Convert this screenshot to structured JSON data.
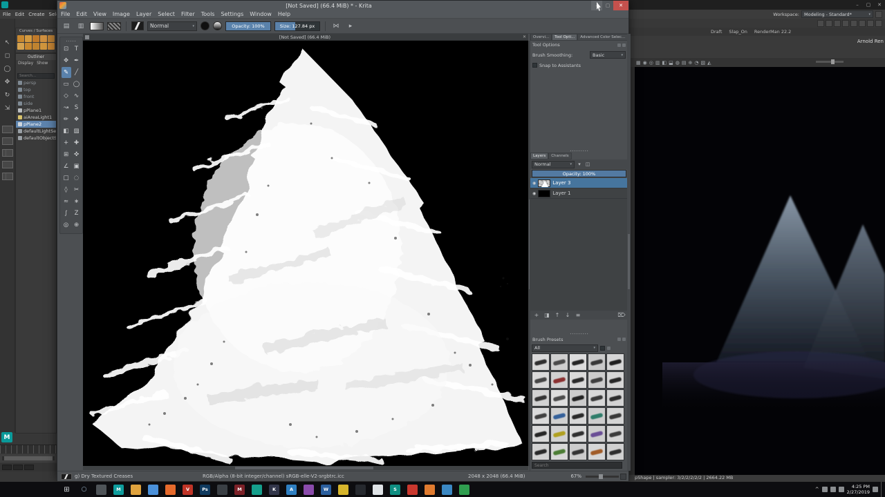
{
  "maya": {
    "menu": [
      "File",
      "Edit",
      "Create",
      "Select"
    ],
    "workspace_label": "Workspace:",
    "workspace_value": "Modeling - Standard*",
    "renderman_draft": "Draft",
    "renderman_snap": "Slap_On",
    "renderman_version": "RenderMan 22.2",
    "render_view_title": "Arnold Ren",
    "shelf_tab": "Curves / Surfaces",
    "shelf_icons": [
      "#c8882f",
      "#d49a3f",
      "#c07a2a",
      "#cf9040",
      "#b97f35",
      "#d4a24f",
      "#c8882f",
      "#bf8330",
      "#d0953d",
      "#c68534"
    ],
    "tool_icons": [
      {
        "g": "↖",
        "n": "select-tool-icon"
      },
      {
        "g": "◻",
        "n": "lasso-select-tool-icon"
      },
      {
        "g": "◯",
        "n": "paint-select-tool-icon"
      },
      {
        "g": "✥",
        "n": "move-tool-icon"
      },
      {
        "g": "↻",
        "n": "rotate-tool-icon"
      },
      {
        "g": "⇲",
        "n": "scale-tool-icon"
      }
    ],
    "outliner": {
      "title": "Outliner",
      "menu_display": "Display",
      "menu_show": "Show",
      "search_placeholder": "Search...",
      "items": [
        {
          "label": "persp",
          "cls": "muted",
          "icon": "#7f8a94"
        },
        {
          "label": "top",
          "cls": "muted",
          "icon": "#7f8a94"
        },
        {
          "label": "front",
          "cls": "muted",
          "icon": "#7f8a94"
        },
        {
          "label": "side",
          "cls": "muted",
          "icon": "#7f8a94"
        },
        {
          "label": "pPlane1",
          "cls": "",
          "icon": "#b9bdc1"
        },
        {
          "label": "aiAreaLight1",
          "cls": "",
          "icon": "#d8c26a"
        },
        {
          "label": "pPlane2",
          "cls": "selected",
          "icon": "#cfd6dd"
        },
        {
          "label": "defaultLightSet",
          "cls": "",
          "icon": "#9aa0a6"
        },
        {
          "label": "defaultObjectSet",
          "cls": "",
          "icon": "#9aa0a6"
        }
      ]
    },
    "viewport_icons": [
      "▦",
      "◉",
      "◎",
      "▥",
      "◧",
      "⬓",
      "◍",
      "▤",
      "⊕",
      "◔",
      "▧",
      "◭"
    ],
    "status_info": "pShape | sampler: 3/2/2/2/2/2 | 2664.22 MB"
  },
  "os": {
    "window_buttons": {
      "minimize": "–",
      "maximize": "▢",
      "close": "✕"
    }
  },
  "krita": {
    "title": "[Not Saved] (66.4 MiB) * - Krita",
    "menu": [
      "File",
      "Edit",
      "View",
      "Image",
      "Layer",
      "Select",
      "Filter",
      "Tools",
      "Settings",
      "Window",
      "Help"
    ],
    "toolbar": {
      "new_icon": "▤",
      "open_icon": "▥",
      "blend_mode": "Normal",
      "opacity_label": "Opacity:",
      "opacity_value": "100%",
      "opacity_fill": "100%",
      "size_label": "Size:",
      "size_value": "127.84 px",
      "size_fill": "46%",
      "mirror_icon": "⋈",
      "wrap_icon": "▸"
    },
    "canvas_tab": "[Not Saved]  (66.4 MiB)",
    "canvas_tab_close": "✕",
    "toolbox": [
      {
        "g": "⊡",
        "n": "transform-tool",
        "cls": ""
      },
      {
        "g": "T",
        "n": "text-tool",
        "cls": ""
      },
      {
        "g": "✥",
        "n": "move-tool",
        "cls": ""
      },
      {
        "g": "✒",
        "n": "calligraphy-tool",
        "cls": ""
      },
      {
        "g": "✎",
        "n": "freehand-brush-tool",
        "cls": "active"
      },
      {
        "g": "╱",
        "n": "line-tool",
        "cls": ""
      },
      {
        "g": "▭",
        "n": "rectangle-tool",
        "cls": ""
      },
      {
        "g": "◯",
        "n": "ellipse-tool",
        "cls": ""
      },
      {
        "g": "◇",
        "n": "polygon-tool",
        "cls": ""
      },
      {
        "g": "∿",
        "n": "polyline-tool",
        "cls": ""
      },
      {
        "g": "↝",
        "n": "bezier-curve-tool",
        "cls": ""
      },
      {
        "g": "S",
        "n": "freehand-path-tool",
        "cls": ""
      },
      {
        "g": "✏",
        "n": "dynamic-brush-tool",
        "cls": ""
      },
      {
        "g": "❖",
        "n": "multibrush-tool",
        "cls": ""
      },
      {
        "g": "◧",
        "n": "fill-tool",
        "cls": ""
      },
      {
        "g": "▨",
        "n": "gradient-tool",
        "cls": ""
      },
      {
        "g": "+",
        "n": "color-sampler-tool",
        "cls": ""
      },
      {
        "g": "✚",
        "n": "smart-patch-tool",
        "cls": ""
      },
      {
        "g": "⊞",
        "n": "crop-tool",
        "cls": ""
      },
      {
        "g": "✜",
        "n": "assistants-tool",
        "cls": ""
      },
      {
        "g": "∠",
        "n": "measure-tool",
        "cls": ""
      },
      {
        "g": "▣",
        "n": "reference-images-tool",
        "cls": ""
      },
      {
        "g": "□",
        "n": "rect-select-tool",
        "cls": ""
      },
      {
        "g": "◌",
        "n": "ellipse-select-tool",
        "cls": ""
      },
      {
        "g": "◊",
        "n": "polygon-select-tool",
        "cls": ""
      },
      {
        "g": "✂",
        "n": "freehand-select-tool",
        "cls": ""
      },
      {
        "g": "≈",
        "n": "contiguous-select-tool",
        "cls": ""
      },
      {
        "g": "∗",
        "n": "similar-select-tool",
        "cls": ""
      },
      {
        "g": "∫",
        "n": "bezier-select-tool",
        "cls": ""
      },
      {
        "g": "Z",
        "n": "magnetic-select-tool",
        "cls": ""
      },
      {
        "g": "◎",
        "n": "zoom-tool",
        "cls": ""
      },
      {
        "g": "⊕",
        "n": "pan-tool",
        "cls": ""
      }
    ],
    "docker_tabs": [
      {
        "label": "Overvi...",
        "cls": ""
      },
      {
        "label": "Tool Opti...",
        "cls": "active"
      },
      {
        "label": "Advanced Color Selec...",
        "cls": ""
      }
    ],
    "tool_options": {
      "title": "Tool Options",
      "brush_smoothing_label": "Brush Smoothing:",
      "brush_smoothing_value": "Basic",
      "snap_label": "Snap to Assistants"
    },
    "layers": {
      "tab_layers": "Layers",
      "tab_channels": "Channels",
      "blend_mode": "Normal",
      "opacity_label": "Opacity:",
      "opacity_value": "100%",
      "opacity_fill": "100%",
      "rows": [
        {
          "name": "Layer 3",
          "cls": "selected",
          "thumb": "thumb-tree",
          "eye": "◉"
        },
        {
          "name": "Layer 1",
          "cls": "",
          "thumb": "thumb-black",
          "eye": "◉"
        }
      ],
      "buttons": [
        {
          "g": "+",
          "n": "add-layer-button"
        },
        {
          "g": "◨",
          "n": "duplicate-layer-button"
        },
        {
          "g": "↑",
          "n": "move-layer-up-button"
        },
        {
          "g": "↓",
          "n": "move-layer-down-button"
        },
        {
          "g": "≡",
          "n": "layer-properties-button"
        },
        {
          "g": "⌦",
          "n": "delete-layer-button"
        }
      ]
    },
    "brush_docker": {
      "title": "Brush Presets",
      "filter_value": "All",
      "search_placeholder": "Search"
    },
    "brush_presets": [
      {
        "bg": "#d9d9d9",
        "s": "#303030"
      },
      {
        "bg": "#cfcfcf",
        "s": "#4a4a4a"
      },
      {
        "bg": "#dddddd",
        "s": "#262626"
      },
      {
        "bg": "#c9c9c9",
        "s": "#383838"
      },
      {
        "bg": "#d5d5d5",
        "s": "#1f1f1f"
      },
      {
        "bg": "#d9d9d9",
        "s": "#454545"
      },
      {
        "bg": "#d0d0d0",
        "s": "#8a3030"
      },
      {
        "bg": "#dadada",
        "s": "#2b2b2b"
      },
      {
        "bg": "#cccccc",
        "s": "#3f3f3f"
      },
      {
        "bg": "#d6d6d6",
        "s": "#272727"
      },
      {
        "bg": "#d2d2d2",
        "s": "#343434"
      },
      {
        "bg": "#dedede",
        "s": "#4d4d4d"
      },
      {
        "bg": "#cbcbcb",
        "s": "#232323"
      },
      {
        "bg": "#d7d7d7",
        "s": "#3a3a3a"
      },
      {
        "bg": "#d3d3d3",
        "s": "#2d2d2d"
      },
      {
        "bg": "#dadada",
        "s": "#414141"
      },
      {
        "bg": "#d0d0d0",
        "s": "#35619b"
      },
      {
        "bg": "#d8d8d8",
        "s": "#2a2a2a"
      },
      {
        "bg": "#cdcdcd",
        "s": "#2f7d6a"
      },
      {
        "bg": "#d4d4d4",
        "s": "#383838"
      },
      {
        "bg": "#d9d9d9",
        "s": "#262626"
      },
      {
        "bg": "#d1d1d1",
        "s": "#b0a020"
      },
      {
        "bg": "#dbdbdb",
        "s": "#303030"
      },
      {
        "bg": "#cecece",
        "s": "#6a4e96"
      },
      {
        "bg": "#d5d5d5",
        "s": "#3c3c3c"
      },
      {
        "bg": "#d2d2d2",
        "s": "#2a2a2a"
      },
      {
        "bg": "#d8d8d8",
        "s": "#4c7d35"
      },
      {
        "bg": "#cccccc",
        "s": "#343434"
      },
      {
        "bg": "#d6d6d6",
        "s": "#a15c28"
      },
      {
        "bg": "#d0d0d0",
        "s": "#2e2e2e"
      }
    ],
    "statusbar": {
      "brush_name": "g) Dry Textured Creases",
      "profile": "RGB/Alpha (8-bit integer/channel)  sRGB-elle-V2-srgbtrc.icc",
      "doc_size": "2048 x 2048 (66.4 MiB)",
      "zoom": "67%"
    }
  },
  "taskbar": {
    "start_icon": "⊞",
    "search_icon": "○",
    "apps": [
      {
        "c": "#4f5458",
        "g": ""
      },
      {
        "c": "#0f9d9d",
        "g": "M"
      },
      {
        "c": "#e0a33e",
        "g": ""
      },
      {
        "c": "#4a90d9",
        "g": ""
      },
      {
        "c": "#e66a2c",
        "g": ""
      },
      {
        "c": "#c03427",
        "g": "V"
      },
      {
        "c": "#0f3a5f",
        "g": "Ps"
      },
      {
        "c": "#3a3f44",
        "g": ""
      },
      {
        "c": "#7c2128",
        "g": "M"
      },
      {
        "c": "#159f8c",
        "g": ""
      },
      {
        "c": "#32364a",
        "g": "K"
      },
      {
        "c": "#2f7fc1",
        "g": "A"
      },
      {
        "c": "#8a4bab",
        "g": ""
      },
      {
        "c": "#2b5f9e",
        "g": "W"
      },
      {
        "c": "#d6b52c",
        "g": ""
      },
      {
        "c": "#26292e",
        "g": ""
      },
      {
        "c": "#dfe3e6",
        "g": ""
      },
      {
        "c": "#0f8f82",
        "g": "S"
      },
      {
        "c": "#c9382e",
        "g": ""
      },
      {
        "c": "#e07b2f",
        "g": ""
      },
      {
        "c": "#3b88c3",
        "g": ""
      },
      {
        "c": "#2f9e4f",
        "g": ""
      }
    ],
    "time": "4:25 PM",
    "date": "2/27/2019"
  }
}
